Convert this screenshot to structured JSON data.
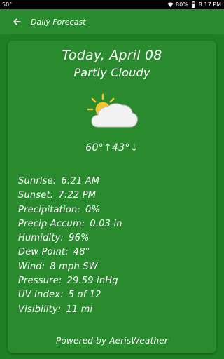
{
  "status_bar": {
    "left_text": "50°",
    "battery": "80%",
    "time": "8:17 PM"
  },
  "app_bar": {
    "back_icon": "arrow-left-icon",
    "title": "Daily Forecast"
  },
  "forecast": {
    "date": "Today, April 08",
    "condition": "Partly Cloudy",
    "icon": "partly-cloudy-icon",
    "temps": "60°↑43°↓",
    "details": [
      {
        "label": "Sunrise:",
        "value": "6:21 AM"
      },
      {
        "label": "Sunset:",
        "value": "7:22 PM"
      },
      {
        "label": "Precipitation:",
        "value": "0%"
      },
      {
        "label": "Precip Accum:",
        "value": "0.03 in"
      },
      {
        "label": "Humidity:",
        "value": "96%"
      },
      {
        "label": "Dew Point:",
        "value": "48°"
      },
      {
        "label": "Wind:",
        "value": "8 mph SW"
      },
      {
        "label": "Pressure:",
        "value": "29.59 inHg"
      },
      {
        "label": "UV Index:",
        "value": "5 of 12"
      },
      {
        "label": "Visibility:",
        "value": "11 mi"
      }
    ],
    "powered_by": "Powered by AerisWeather"
  },
  "colors": {
    "background": "#1f7f25",
    "card": "#2a8a2e",
    "sun": "#f4c430",
    "cloud": "#f2f2f2"
  }
}
